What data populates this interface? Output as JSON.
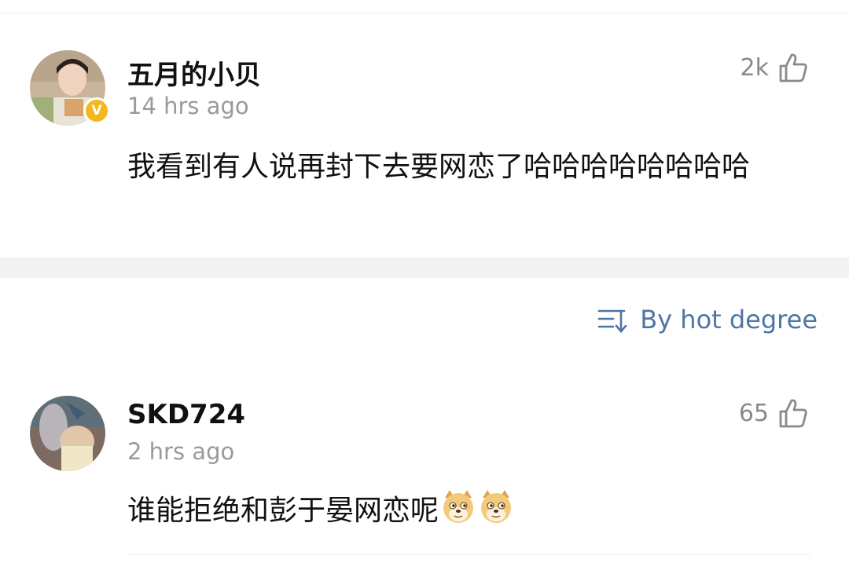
{
  "comments": [
    {
      "username": "五月的小贝",
      "time": "14 hrs ago",
      "likes": "2k",
      "text": "我看到有人说再封下去要网恋了哈哈哈哈哈哈哈哈",
      "verified_badge": "V"
    },
    {
      "username": "SKD724",
      "time": "2 hrs ago",
      "likes": "65",
      "text": "谁能拒绝和彭于晏网恋呢",
      "emojis": [
        "doge-emoji",
        "doge-emoji"
      ]
    }
  ],
  "sort": {
    "label": "By hot degree",
    "icon": "sort-icon"
  },
  "icons": {
    "like": "thumbs-up-icon"
  },
  "colors": {
    "accent": "#4e75a6",
    "muted": "#9a9a9a",
    "badge": "#f5b71e",
    "separator": "#f2f2f2"
  }
}
